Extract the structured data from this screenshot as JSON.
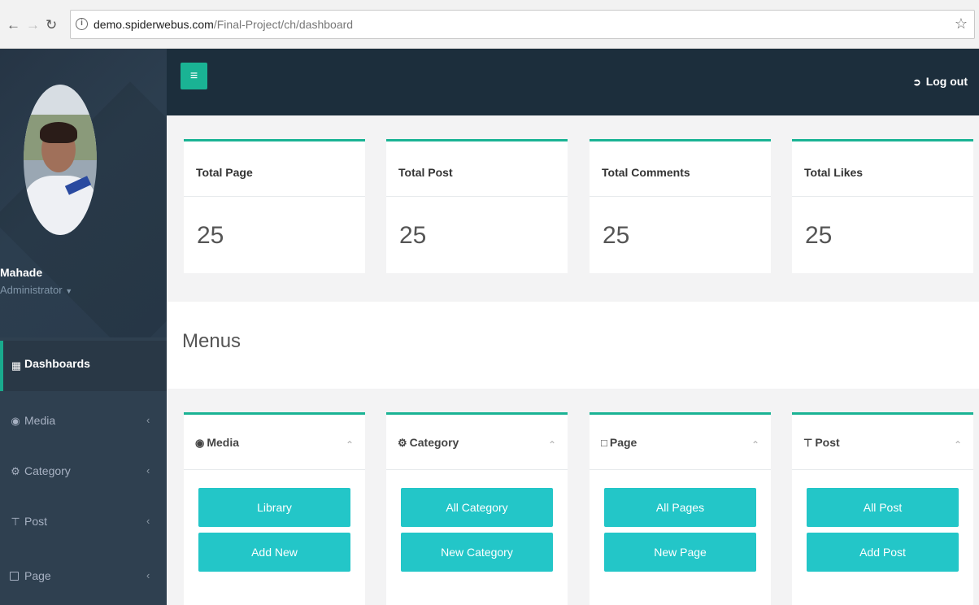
{
  "browser": {
    "url_host": "demo.spiderwebus.com",
    "url_path": "/Final-Project/ch/dashboard"
  },
  "sidebar": {
    "user_name": "Mahade",
    "user_role": "Administrator",
    "items": [
      {
        "label": "Dashboards",
        "icon": "grid-icon",
        "active": true
      },
      {
        "label": "Media",
        "icon": "camera-icon"
      },
      {
        "label": "Category",
        "icon": "cogs-icon"
      },
      {
        "label": "Post",
        "icon": "pin-icon"
      },
      {
        "label": "Page",
        "icon": "file-icon"
      }
    ]
  },
  "topbar": {
    "toggle_icon": "hamburger-icon",
    "logout_label": "Log out"
  },
  "stats": [
    {
      "title": "Total Page",
      "value": "25"
    },
    {
      "title": "Total Post",
      "value": "25"
    },
    {
      "title": "Total Comments",
      "value": "25"
    },
    {
      "title": "Total Likes",
      "value": "25"
    }
  ],
  "menus": {
    "title": "Menus",
    "cards": [
      {
        "title": "Media",
        "icon": "camera-icon",
        "buttons": [
          "Library",
          "Add New"
        ]
      },
      {
        "title": "Category",
        "icon": "cogs-icon",
        "buttons": [
          "All Category",
          "New Category"
        ]
      },
      {
        "title": "Page",
        "icon": "file-icon",
        "buttons": [
          "All Pages",
          "New Page"
        ]
      },
      {
        "title": "Post",
        "icon": "pin-icon",
        "buttons": [
          "All Post",
          "Add Post"
        ]
      }
    ]
  },
  "colors": {
    "sidebar": "#2f4050",
    "topbar": "#1c2e3c",
    "accent": "#1ab394",
    "button": "#23c6c8"
  }
}
